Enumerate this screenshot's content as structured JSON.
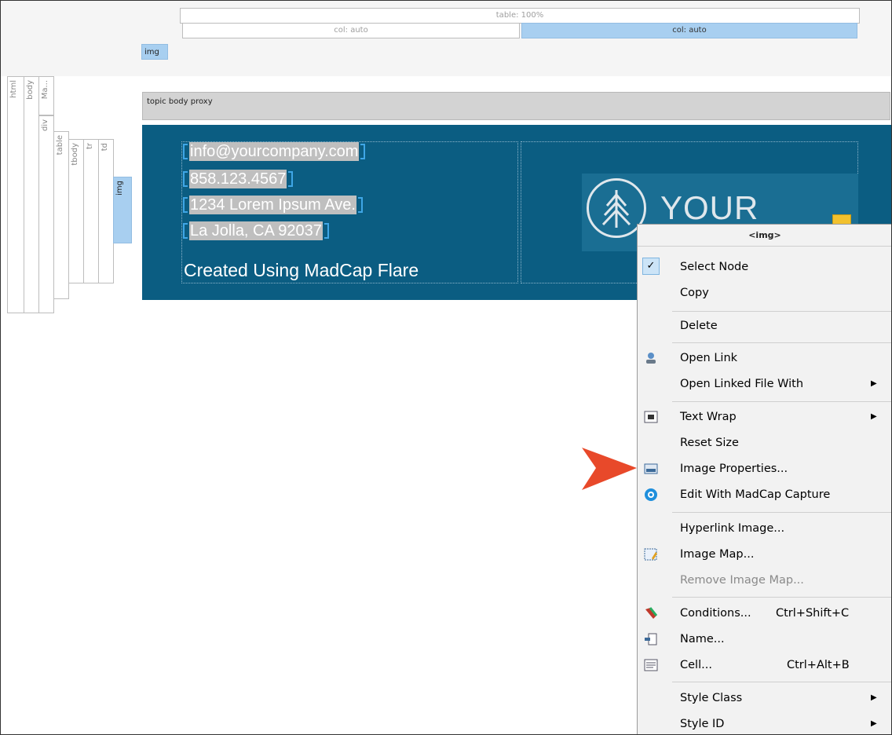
{
  "structure_bar": {
    "table_label": "table: 100%",
    "col1_label": "col: auto",
    "col2_label": "col: auto",
    "img_label": "img"
  },
  "left_bars": [
    {
      "label": "html"
    },
    {
      "label": "body"
    },
    {
      "label": "Ma..."
    },
    {
      "label": "div"
    },
    {
      "label": "table"
    },
    {
      "label": "tbody"
    },
    {
      "label": "tr"
    },
    {
      "label": "td"
    },
    {
      "label": "img"
    }
  ],
  "proxy": {
    "label": "topic body proxy"
  },
  "footer": {
    "lines": [
      "info@yourcompany.com",
      "858.123.4567",
      "1234 Lorem Ipsum Ave.",
      "La Jolla, CA 92037"
    ],
    "created": "Created Using MadCap Flare",
    "logo_text": "YOUR LOGO"
  },
  "menu": {
    "header": "<img>",
    "items": [
      {
        "label": "Select Node",
        "icon": "check-icon",
        "checked": true
      },
      {
        "label": "Copy"
      },
      {
        "label": "Delete"
      },
      {
        "label": "Open Link",
        "icon": "open-link-icon"
      },
      {
        "label": "Open Linked File With",
        "submenu": true
      },
      {
        "label": "Text Wrap",
        "icon": "text-wrap-icon",
        "submenu": true
      },
      {
        "label": "Reset Size"
      },
      {
        "label": "Image Properties...",
        "icon": "image-properties-icon"
      },
      {
        "label": "Edit With MadCap Capture",
        "icon": "capture-icon"
      },
      {
        "label": "Hyperlink Image..."
      },
      {
        "label": "Image Map...",
        "icon": "image-map-icon"
      },
      {
        "label": "Remove Image Map...",
        "disabled": true
      },
      {
        "label": "Conditions...",
        "shortcut": "Ctrl+Shift+C",
        "icon": "conditions-icon"
      },
      {
        "label": "Name...",
        "icon": "name-icon"
      },
      {
        "label": "Cell...",
        "shortcut": "Ctrl+Alt+B",
        "icon": "cell-icon"
      },
      {
        "label": "Style Class",
        "submenu": true
      },
      {
        "label": "Style ID",
        "submenu": true
      }
    ]
  },
  "colors": {
    "footer_bg": "#0b5d82",
    "selection_blue": "#a8cff0",
    "arrow": "#e8492a"
  }
}
